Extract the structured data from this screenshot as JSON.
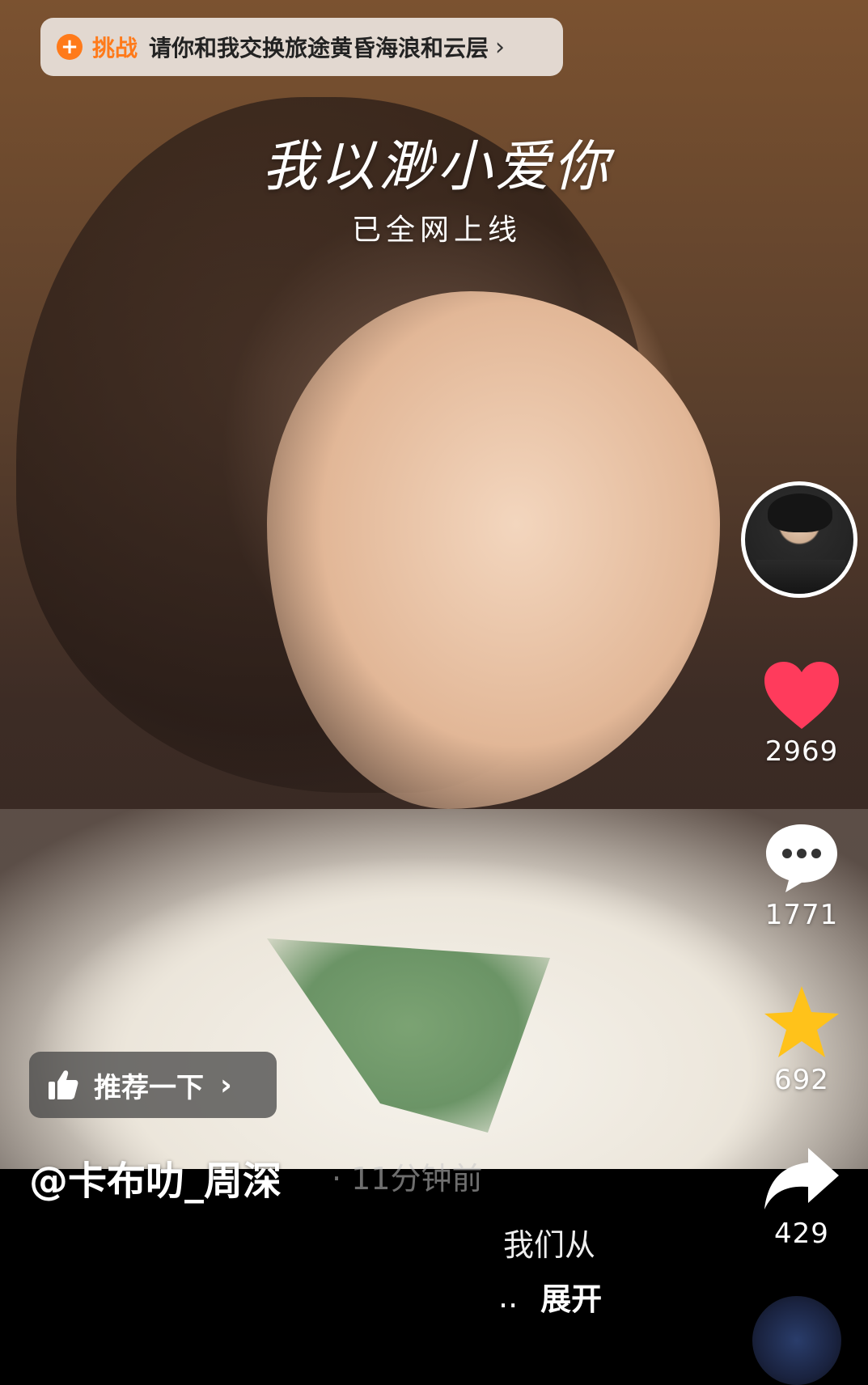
{
  "challenge": {
    "tag": "挑战",
    "title": "请你和我交换旅途黄昏海浪和云层",
    "icon": "plus-circle-icon",
    "chevron": "›"
  },
  "video": {
    "song_title": "我以渺小爱你",
    "song_subtitle": "已全网上线"
  },
  "rail": {
    "likes": "2969",
    "comments": "1771",
    "favorites": "692",
    "shares": "429",
    "colors": {
      "like": "#ff3b5c",
      "favorite": "#ffc21a",
      "comment": "#ffffff",
      "share": "#ffffff"
    }
  },
  "recommend": {
    "label": "推荐一下",
    "icon": "thumbs-up-icon",
    "chevron": "›"
  },
  "post": {
    "author": "@卡布叻_周深",
    "time": "· 11分钟前",
    "caption": "我们从",
    "ellipsis": "..",
    "expand": "展开"
  }
}
